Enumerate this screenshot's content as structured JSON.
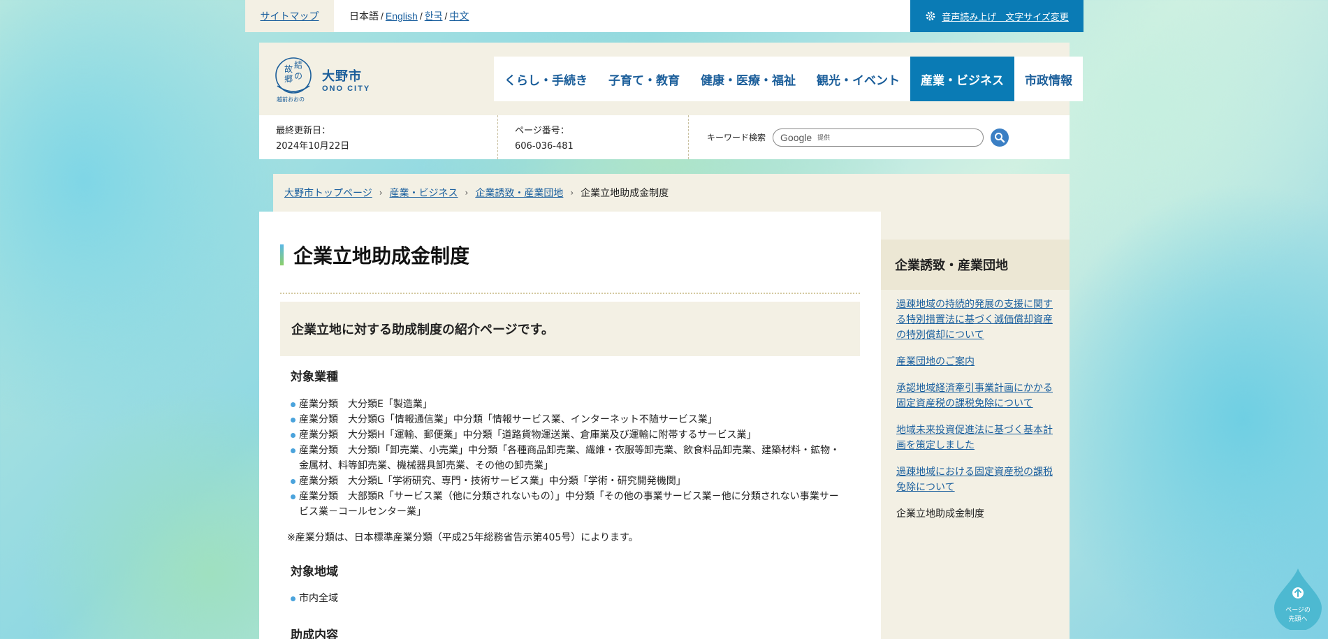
{
  "utility": {
    "sitemap": "サイトマップ",
    "lang_current": "日本語",
    "langs": [
      "English",
      "한국",
      "中文"
    ],
    "separator": "/",
    "access": "音声読み上げ　文字サイズ変更"
  },
  "logo": {
    "badge": "故郷の結",
    "badge_sub": "越前おおの",
    "jp": "大野市",
    "en": "ONO CITY"
  },
  "gnav": [
    "くらし・手続き",
    "子育て・教育",
    "健康・医療・福祉",
    "観光・イベント",
    "産業・ビジネス",
    "市政情報"
  ],
  "info": {
    "updated_label": "最終更新日：",
    "updated_value": "2024年10月22日",
    "page_no_label": "ページ番号：",
    "page_no_value": "606-036-481",
    "search_label": "キーワード検索",
    "search_google": "Google",
    "search_provided": "提供"
  },
  "breadcrumb": [
    "大野市トップページ",
    "産業・ビジネス",
    "企業誘致・産業団地",
    "企業立地助成金制度"
  ],
  "main": {
    "title": "企業立地助成金制度",
    "lead": "企業立地に対する助成制度の紹介ページです。",
    "section1_heading": "対象業種",
    "industries": [
      "産業分類　大分類E「製造業」",
      "産業分類　大分類G「情報通信業」中分類「情報サービス業、インターネット不随サービス業」",
      "産業分類　大分類H「運輸、郵便業」中分類「道路貨物運送業、倉庫業及び運輸に附帯するサービス業」",
      "産業分類　大分類I「卸売業、小売業」中分類「各種商品卸売業、繊維・衣服等卸売業、飲食料品卸売業、建築材料・鉱物・金属材、料等卸売業、機械器具卸売業、その他の卸売業」",
      "産業分類　大分類L「学術研究、専門・技術サービス業」中分類「学術・研究開発機関」",
      "産業分類　大部類R「サービス業（他に分類されないもの）」中分類「その他の事業サービス業－他に分類されない事業サービス業－コールセンター業」"
    ],
    "note": "※産業分類は、日本標準産業分類（平成25年総務省告示第405号）によります。",
    "section2_heading": "対象地域",
    "regions": [
      "市内全域"
    ],
    "section3_heading": "助成内容"
  },
  "side": {
    "heading": "企業誘致・産業団地",
    "links": [
      "過疎地域の持続的発展の支援に関する特別措置法に基づく減価償却資産の特別償却について",
      "産業団地のご案内",
      "承認地域経済牽引事業計画にかかる固定資産税の課税免除について",
      "地域未来投資促進法に基づく基本計画を策定しました",
      "過疎地域における固定資産税の課税免除について"
    ],
    "current": "企業立地助成金制度"
  },
  "pagetop": {
    "line1": "ページの",
    "line2": "先頭へ"
  },
  "colors": {
    "accent": "#0a7bb5",
    "beige": "#f3f0e4",
    "link": "#1a5f9e"
  }
}
